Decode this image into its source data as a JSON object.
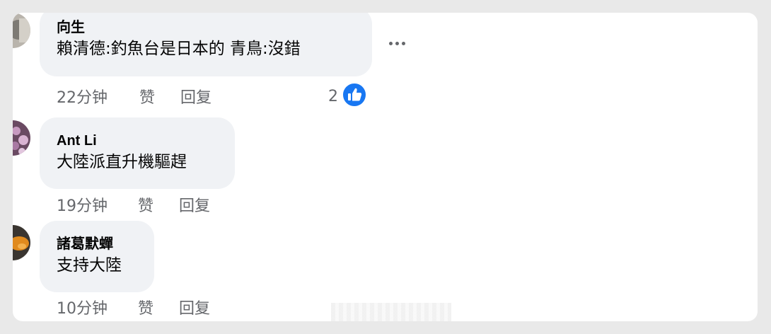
{
  "comments": [
    {
      "author": "向生",
      "text": "賴清德:釣魚台是日本的 青鳥:沒錯",
      "time": "22分钟",
      "like_label": "赞",
      "reply_label": "回复",
      "reaction_count": "2"
    },
    {
      "author": "Ant Li",
      "text": "大陸派直升機驅趕",
      "time": "19分钟",
      "like_label": "赞",
      "reply_label": "回复"
    },
    {
      "author": "諸葛默蟬",
      "text": "支持大陸",
      "time": "10分钟",
      "like_label": "赞",
      "reply_label": "回复"
    }
  ],
  "colors": {
    "bubble": "#f0f2f5",
    "meta_text": "#65676b",
    "like_blue": "#1877f2"
  },
  "icons": [
    "more-options-icon",
    "like-reaction-icon"
  ]
}
